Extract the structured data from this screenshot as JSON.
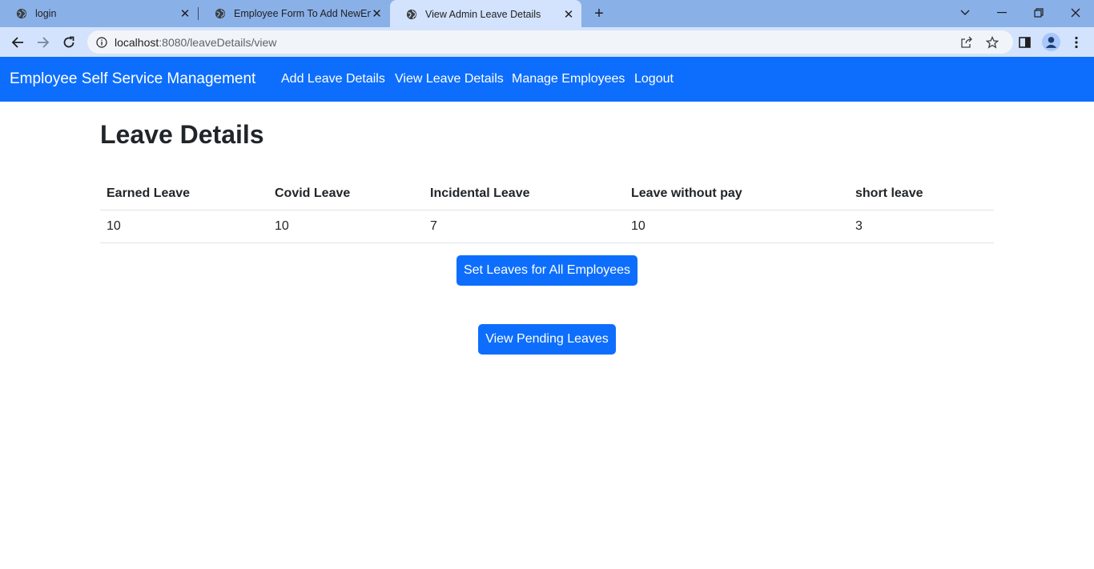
{
  "browser": {
    "tabs": [
      {
        "title": "login"
      },
      {
        "title": "Employee Form To Add NewEmp"
      },
      {
        "title": "View Admin Leave Details"
      }
    ],
    "url_host": "localhost",
    "url_path": ":8080/leaveDetails/view"
  },
  "navbar": {
    "brand": "Employee Self Service Management",
    "links": [
      "Add Leave Details",
      "View Leave Details",
      "Manage Employees",
      "Logout"
    ]
  },
  "page": {
    "title": "Leave Details",
    "table": {
      "headers": [
        "Earned Leave",
        "Covid Leave",
        "Incidental Leave",
        "Leave without pay",
        "short leave"
      ],
      "rows": [
        [
          "10",
          "10",
          "7",
          "10",
          "3"
        ]
      ]
    },
    "set_leaves_button": "Set Leaves for All Employees",
    "view_pending_button": "View Pending Leaves"
  },
  "colors": {
    "primary": "#0d6efd",
    "tabstrip": "#8ab0e8",
    "active_tab": "#d3e3fd"
  }
}
